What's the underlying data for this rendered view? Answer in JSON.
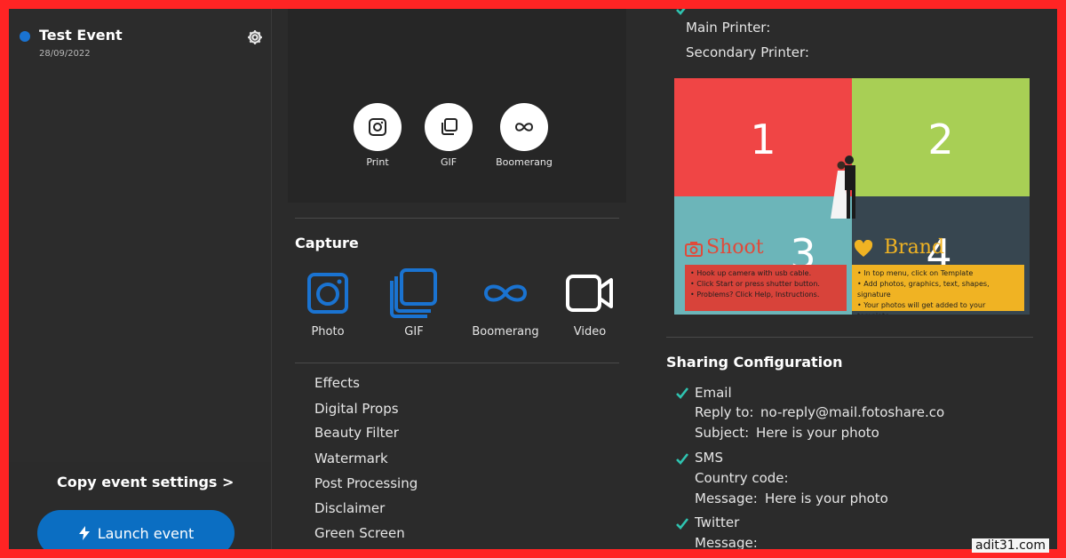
{
  "sidebar": {
    "event_name": "Test Event",
    "event_date": "28/09/2022",
    "copy_settings_label": "Copy event settings >",
    "launch_label": "Launch event"
  },
  "preview": {
    "buttons": [
      {
        "label": "Print",
        "icon": "camera-icon"
      },
      {
        "label": "GIF",
        "icon": "gif-icon"
      },
      {
        "label": "Boomerang",
        "icon": "infinity-icon"
      }
    ]
  },
  "capture": {
    "title": "Capture",
    "items": [
      {
        "label": "Photo",
        "icon": "camera-icon",
        "color": "#1a73d1"
      },
      {
        "label": "GIF",
        "icon": "gif-icon",
        "color": "#1a73d1"
      },
      {
        "label": "Boomerang",
        "icon": "infinity-icon",
        "color": "#1a73d1"
      },
      {
        "label": "Video",
        "icon": "video-icon",
        "color": "#ffffff"
      }
    ]
  },
  "menu": [
    "Effects",
    "Digital Props",
    "Beauty Filter",
    "Watermark",
    "Post Processing",
    "Disclaimer",
    "Green Screen"
  ],
  "printers": {
    "main_label": "Main Printer:",
    "secondary_label": "Secondary Printer:"
  },
  "template": {
    "quadrants": [
      "1",
      "2",
      "3",
      "4"
    ],
    "colors": [
      "#f04545",
      "#a8cf55",
      "#6cb5b9",
      "#374650"
    ],
    "shoot_title": "Shoot",
    "brand_title": "Brand",
    "shoot_lines": [
      "• Hook up camera with usb cable.",
      "• Click Start or press shutter button.",
      "• Problems? Click Help, Instructions."
    ],
    "brand_lines": [
      "• In top menu, click on Template",
      "• Add photos, graphics, text, shapes, signature",
      "• Your photos will get added to your template."
    ]
  },
  "sharing": {
    "title": "Sharing Configuration",
    "email_label": "Email",
    "reply_to_label": "Reply to:",
    "reply_to_value": "no-reply@mail.fotoshare.co",
    "subject_label": "Subject:",
    "subject_value": "Here is your photo",
    "sms_label": "SMS",
    "country_code_label": "Country code:",
    "sms_message_label": "Message:",
    "sms_message_value": "Here is your photo",
    "twitter_label": "Twitter",
    "twitter_message_label": "Message:",
    "check_color": "#2fc3b0"
  },
  "watermark": "adit31.com"
}
